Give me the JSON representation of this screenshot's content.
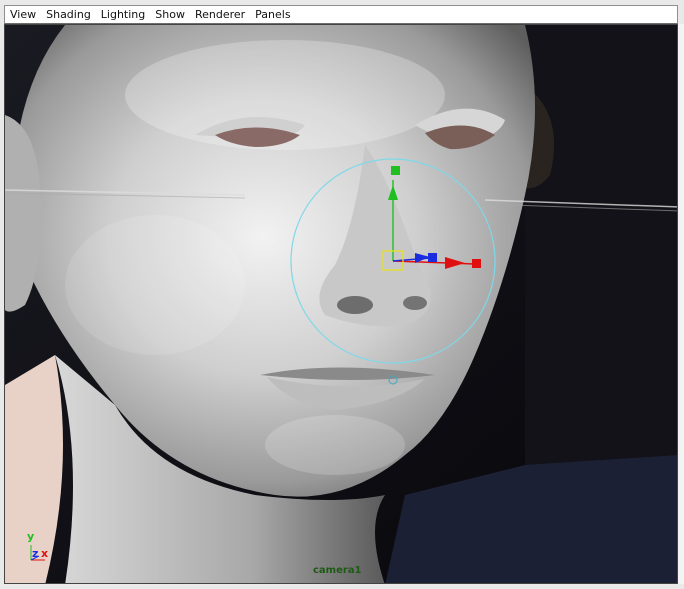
{
  "menu": {
    "items": [
      "View",
      "Shading",
      "Lighting",
      "Show",
      "Renderer",
      "Panels"
    ]
  },
  "viewport": {
    "camera_label": "camera1",
    "axis": {
      "y": "y",
      "z": "z",
      "x": "x"
    }
  },
  "colors": {
    "manipulator_ring": "#7fd8e8",
    "y_axis": "#1fbf1f",
    "x_axis": "#e01010",
    "z_axis": "#1a2ee0",
    "pivot": "#e8e020",
    "background": "#0b0b10"
  },
  "icons": [
    "move-manipulator-icon",
    "view-axis-icon"
  ]
}
